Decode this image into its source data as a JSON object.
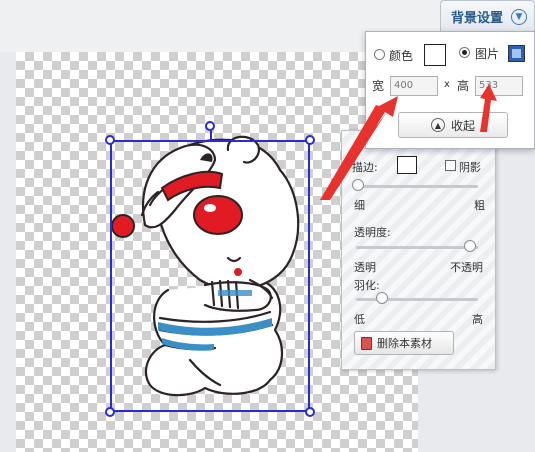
{
  "bg_tab": {
    "title": "背景设置",
    "icon": "chevron-circle-down-icon"
  },
  "bg_panel": {
    "color_label": "颜色",
    "image_label": "图片",
    "width_label": "宽",
    "width_value": "400",
    "times": "x",
    "height_label": "高",
    "height_value": "533",
    "collapse_label": "收起",
    "selected_mode": "图片"
  },
  "prop_panel": {
    "stroke_label": "描边:",
    "shadow_label": "阴影",
    "thin_label": "细",
    "thick_label": "粗",
    "opacity_label": "透明度:",
    "transparent_label": "透明",
    "opaque_label": "不透明",
    "feather_label": "羽化:",
    "low_label": "低",
    "high_label": "高",
    "delete_label": "删除本素材",
    "stroke_level": 0,
    "opacity_level": 1,
    "feather_level": 0.2
  },
  "colors": {
    "selection": "#2b2bd6",
    "annotation_arrow": "#e8322e",
    "accent": "#2a5a8a"
  }
}
